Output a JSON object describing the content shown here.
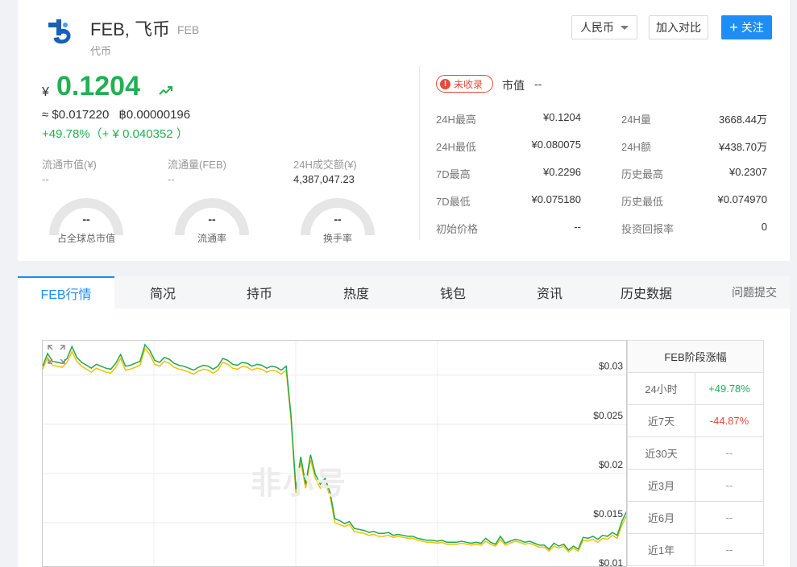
{
  "coin": {
    "name": "FEB, 飞币",
    "symbol": "FEB",
    "type": "代币"
  },
  "header_buttons": {
    "currency": "人民币",
    "compare": "加入对比",
    "follow": "关注"
  },
  "price": {
    "currency_symbol": "¥",
    "value": "0.1204",
    "usd": "≈ $0.017220",
    "btc": "฿0.00000196",
    "change": "+49.78%（+ ¥ 0.040352 ）"
  },
  "stats": [
    {
      "label": "流通市值(¥)",
      "value": "--"
    },
    {
      "label": "流通量(FEB)",
      "value": "--"
    },
    {
      "label": "24H成交额(¥)",
      "value": "4,387,047.23"
    }
  ],
  "gauges": [
    {
      "value": "--",
      "label": "占全球总市值"
    },
    {
      "value": "--",
      "label": "流通率"
    },
    {
      "value": "--",
      "label": "换手率"
    }
  ],
  "market": {
    "badge": "未收录",
    "cap_label": "市值",
    "cap_value": "--",
    "left_rows": [
      {
        "label": "24H最高",
        "value": "¥0.1204"
      },
      {
        "label": "24H最低",
        "value": "¥0.080075"
      },
      {
        "label": "7D最高",
        "value": "¥0.2296"
      },
      {
        "label": "7D最低",
        "value": "¥0.075180"
      },
      {
        "label": "初始价格",
        "value": "--"
      }
    ],
    "right_rows": [
      {
        "label": "24H量",
        "value": "3668.44万"
      },
      {
        "label": "24H额",
        "value": "¥438.70万"
      },
      {
        "label": "历史最高",
        "value": "¥0.2307"
      },
      {
        "label": "历史最低",
        "value": "¥0.074970"
      },
      {
        "label": "投资回报率",
        "value": "0"
      }
    ]
  },
  "tabs": [
    "FEB行情",
    "简况",
    "持币",
    "热度",
    "钱包",
    "资讯",
    "历史数据"
  ],
  "feedback_tab": "问题提交",
  "chart": {
    "watermark": "非小号",
    "y_ticks": [
      "$0.03",
      "$0.025",
      "$0.02",
      "$0.015",
      "$0.01"
    ]
  },
  "chart_data": {
    "type": "line",
    "ylim": [
      0.0095,
      0.0326
    ],
    "x": [
      0,
      1,
      2,
      3,
      4,
      5,
      6,
      7,
      8,
      9,
      10,
      11,
      12,
      13,
      14,
      15,
      16,
      17,
      18,
      19,
      20,
      21,
      22,
      23,
      24,
      25,
      26,
      27,
      28,
      29,
      30,
      31,
      32,
      33,
      34,
      35,
      36,
      37,
      38,
      39,
      40,
      41,
      42,
      43,
      44,
      45,
      46,
      47,
      48,
      49,
      50,
      51,
      52,
      53,
      54,
      55,
      56,
      57,
      58,
      59,
      60,
      61,
      62,
      63,
      64,
      65,
      66,
      67,
      68,
      69,
      70,
      71,
      72,
      73,
      74,
      75,
      76,
      77,
      78,
      79,
      80,
      81,
      82,
      83,
      84,
      85,
      86,
      87,
      88,
      89,
      90,
      91,
      92,
      93,
      94,
      95,
      96,
      97,
      98,
      99,
      100,
      101,
      102,
      103,
      104,
      105,
      106,
      107,
      108,
      109,
      110,
      111,
      112,
      113,
      114,
      115,
      116,
      117,
      118,
      119,
      120
    ],
    "series": [
      {
        "color": "#21a94e",
        "values": [
          0.03,
          0.0313,
          0.0305,
          0.0304,
          0.0303,
          0.0308,
          0.032,
          0.0309,
          0.0304,
          0.0301,
          0.0298,
          0.0302,
          0.03,
          0.0298,
          0.0297,
          0.0303,
          0.0312,
          0.03,
          0.0301,
          0.0303,
          0.0305,
          0.0322,
          0.0316,
          0.0306,
          0.0304,
          0.0309,
          0.0307,
          0.0303,
          0.0301,
          0.03,
          0.0298,
          0.0296,
          0.0299,
          0.0301,
          0.03,
          0.0297,
          0.03,
          0.0308,
          0.0306,
          0.0302,
          0.0301,
          0.0304,
          0.0303,
          0.03,
          0.0302,
          0.0301,
          0.0298,
          0.03,
          0.0299,
          0.0296,
          0.03,
          0.025,
          0.0175,
          0.0208,
          0.018,
          0.021,
          0.019,
          0.018,
          0.0186,
          0.0172,
          0.0145,
          0.0143,
          0.014,
          0.0142,
          0.0135,
          0.0134,
          0.0133,
          0.0131,
          0.0132,
          0.013,
          0.013,
          0.0131,
          0.0128,
          0.0129,
          0.0128,
          0.0127,
          0.0127,
          0.0125,
          0.0124,
          0.0123,
          0.0123,
          0.0122,
          0.0123,
          0.0121,
          0.0121,
          0.0121,
          0.0122,
          0.0121,
          0.012,
          0.0121,
          0.012,
          0.0125,
          0.0121,
          0.0119,
          0.0127,
          0.012,
          0.0122,
          0.0124,
          0.0123,
          0.0121,
          0.0122,
          0.012,
          0.0118,
          0.0118,
          0.0114,
          0.012,
          0.0117,
          0.0119,
          0.0113,
          0.0117,
          0.0114,
          0.0126,
          0.0125,
          0.0127,
          0.0124,
          0.0128,
          0.0127,
          0.0131,
          0.0128,
          0.0143,
          0.0153
        ]
      },
      {
        "color": "#f5c000",
        "values": [
          0.0297,
          0.0309,
          0.0301,
          0.03,
          0.0299,
          0.0304,
          0.0315,
          0.0305,
          0.03,
          0.0297,
          0.0294,
          0.0298,
          0.0296,
          0.0294,
          0.0293,
          0.0299,
          0.0308,
          0.0296,
          0.0297,
          0.0299,
          0.0301,
          0.0318,
          0.0312,
          0.0302,
          0.03,
          0.0305,
          0.0303,
          0.0299,
          0.0297,
          0.0296,
          0.0294,
          0.0292,
          0.0295,
          0.0297,
          0.0296,
          0.0293,
          0.0296,
          0.0304,
          0.0302,
          0.0298,
          0.0297,
          0.03,
          0.0299,
          0.0296,
          0.0298,
          0.0297,
          0.0294,
          0.0296,
          0.0295,
          0.0292,
          0.0296,
          0.0246,
          0.0171,
          0.0203,
          0.0176,
          0.0205,
          0.0186,
          0.0176,
          0.0182,
          0.0168,
          0.0141,
          0.0139,
          0.0137,
          0.0139,
          0.0132,
          0.0131,
          0.013,
          0.0128,
          0.0129,
          0.0127,
          0.0127,
          0.0128,
          0.0126,
          0.0127,
          0.0126,
          0.0125,
          0.0125,
          0.0123,
          0.0122,
          0.0121,
          0.0121,
          0.012,
          0.0121,
          0.0119,
          0.0119,
          0.0119,
          0.012,
          0.0119,
          0.0118,
          0.0119,
          0.0118,
          0.0122,
          0.0119,
          0.0117,
          0.0124,
          0.0118,
          0.012,
          0.0122,
          0.0121,
          0.0119,
          0.012,
          0.0118,
          0.0116,
          0.0116,
          0.0112,
          0.0117,
          0.0115,
          0.0117,
          0.0111,
          0.0115,
          0.0112,
          0.0123,
          0.0122,
          0.0124,
          0.0121,
          0.0125,
          0.0124,
          0.0128,
          0.0125,
          0.0139,
          0.0149
        ]
      }
    ]
  },
  "period_table": {
    "title": "FEB阶段涨幅",
    "rows": [
      {
        "label": "24小时",
        "value": "+49.78%",
        "dir": "up"
      },
      {
        "label": "近7天",
        "value": "-44.87%",
        "dir": "down"
      },
      {
        "label": "近30天",
        "value": "--",
        "dir": ""
      },
      {
        "label": "近3月",
        "value": "--",
        "dir": ""
      },
      {
        "label": "近6月",
        "value": "--",
        "dir": ""
      },
      {
        "label": "近1年",
        "value": "--",
        "dir": ""
      }
    ]
  }
}
